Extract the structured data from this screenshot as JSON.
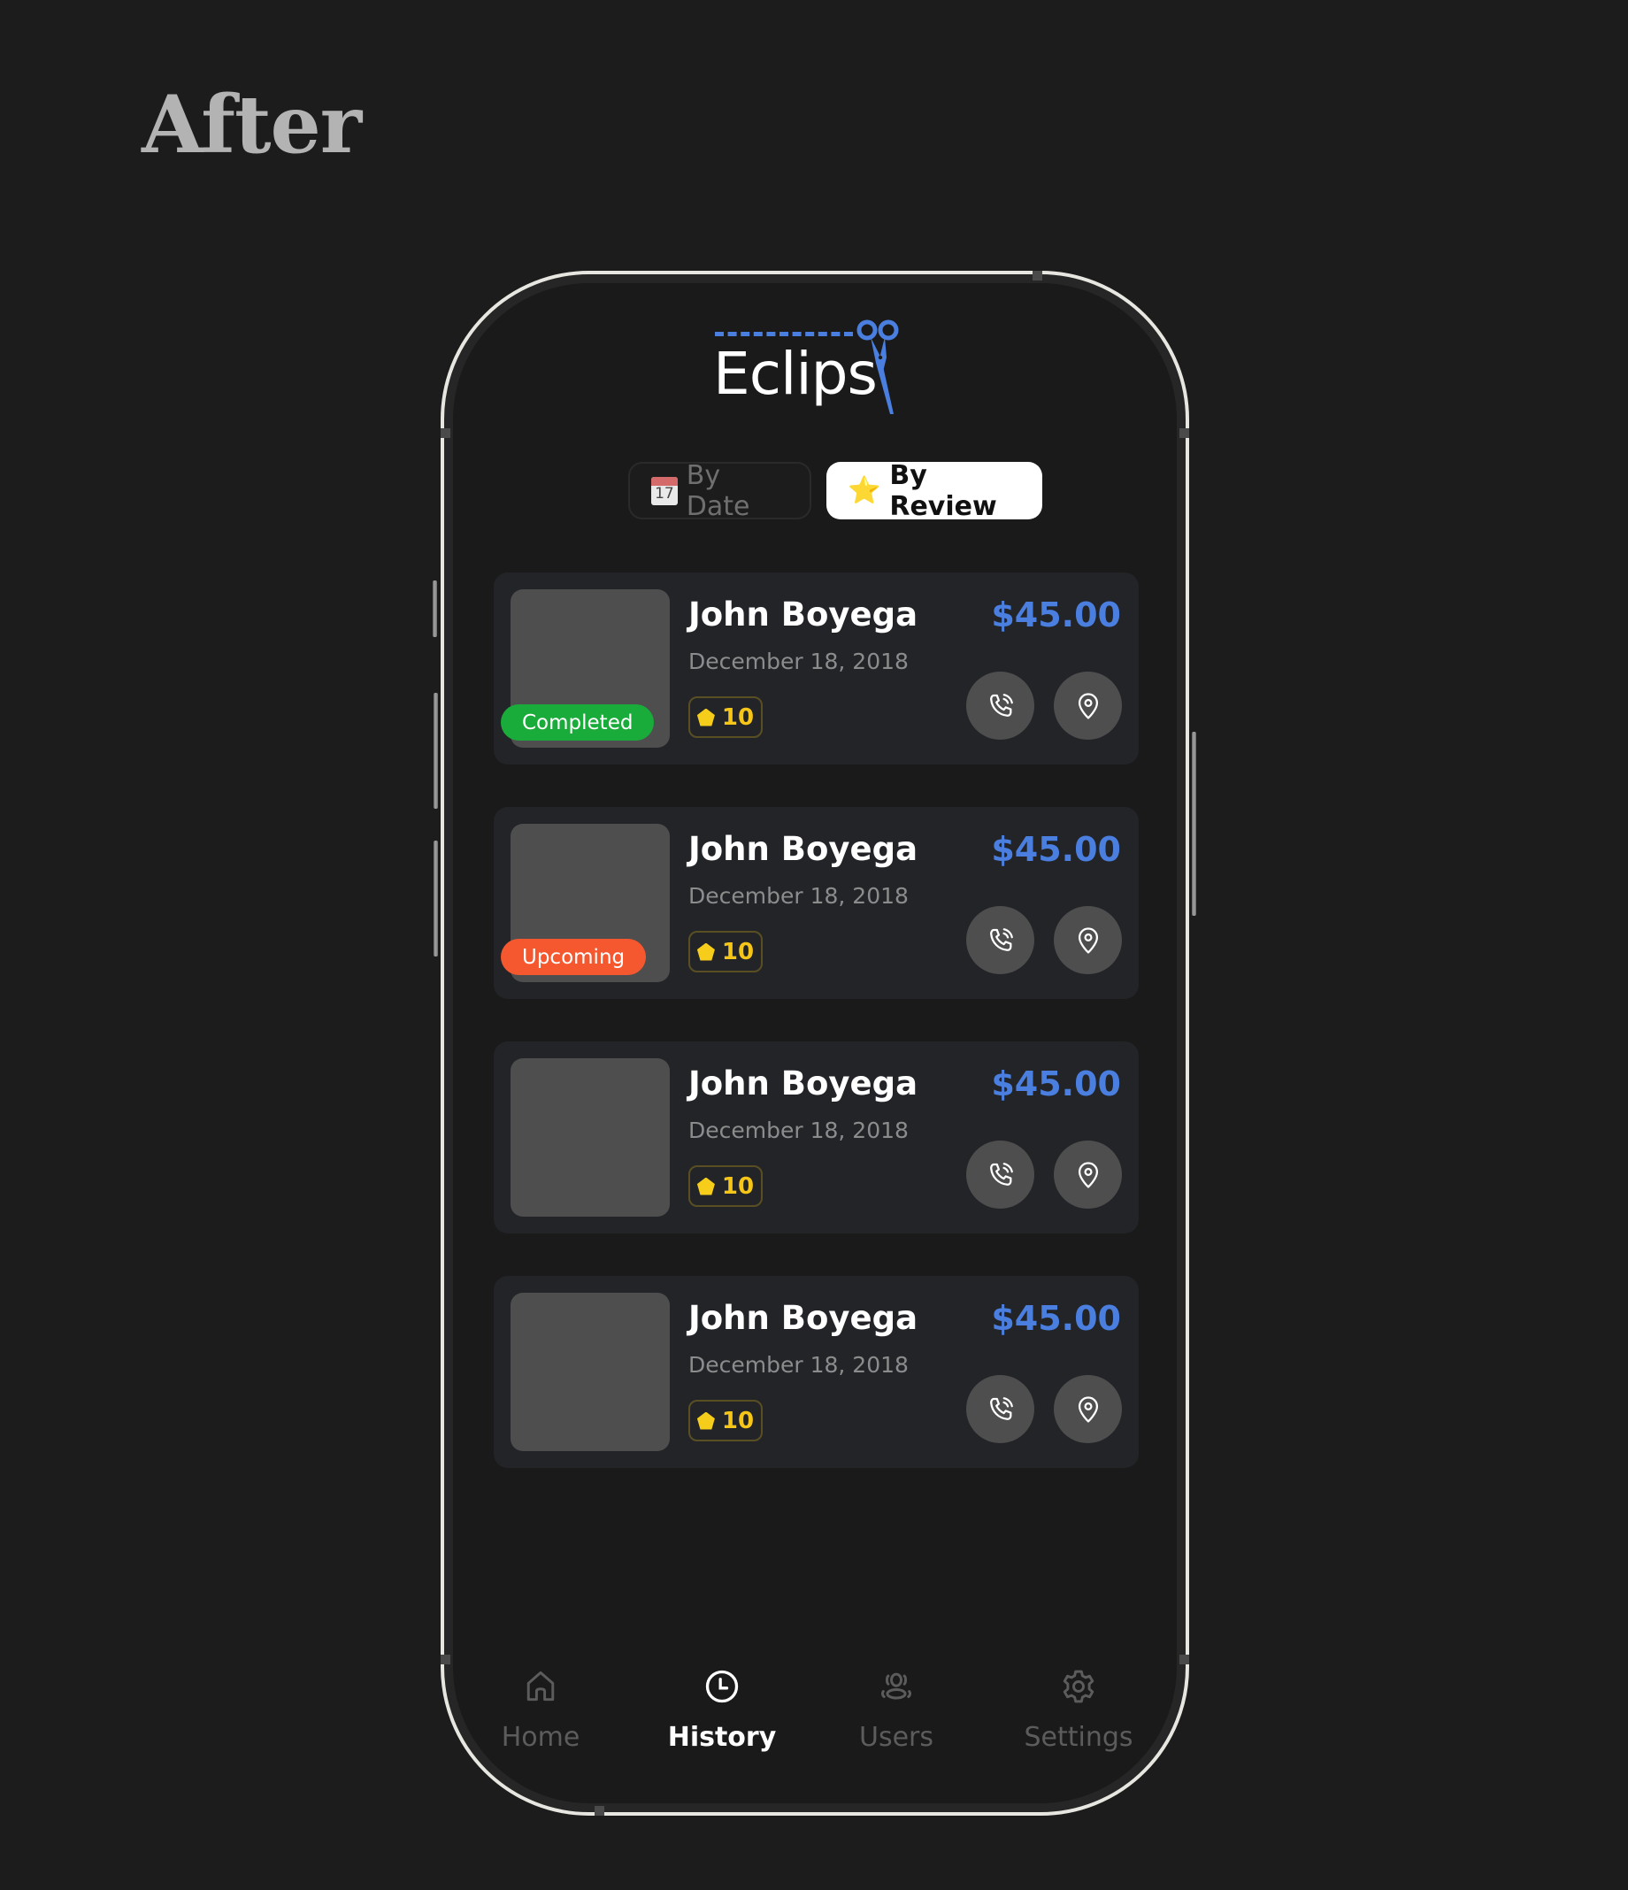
{
  "page": {
    "title": "After"
  },
  "app": {
    "logo_text": "Eclips",
    "accent_color": "#4a7fe0"
  },
  "filters": {
    "tabs": [
      {
        "label": "By Date",
        "icon": "calendar-icon",
        "icon_day": "17",
        "active": false
      },
      {
        "label": "By Review",
        "icon": "star-icon",
        "icon_glyph": "⭐",
        "active": true
      }
    ]
  },
  "appointments": [
    {
      "name": "John Boyega",
      "date": "December 18, 2018",
      "price": "$45.00",
      "rating": "10",
      "status": "Completed",
      "status_color": "#1aac3a"
    },
    {
      "name": "John Boyega",
      "date": "December 18, 2018",
      "price": "$45.00",
      "rating": "10",
      "status": "Upcoming",
      "status_color": "#f5582f"
    },
    {
      "name": "John Boyega",
      "date": "December 18, 2018",
      "price": "$45.00",
      "rating": "10",
      "status": null,
      "status_color": null
    },
    {
      "name": "John Boyega",
      "date": "December 18, 2018",
      "price": "$45.00",
      "rating": "10",
      "status": null,
      "status_color": null
    }
  ],
  "nav": {
    "items": [
      {
        "label": "Home",
        "icon": "home-icon",
        "active": false
      },
      {
        "label": "History",
        "icon": "clock-icon",
        "active": true
      },
      {
        "label": "Users",
        "icon": "users-icon",
        "active": false
      },
      {
        "label": "Settings",
        "icon": "gear-icon",
        "active": false
      }
    ]
  }
}
